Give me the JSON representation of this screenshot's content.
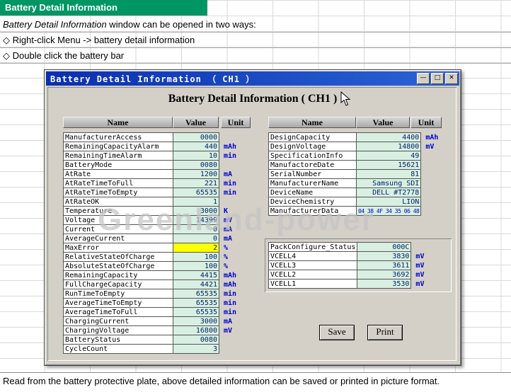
{
  "colors": {
    "header_green": "#009664",
    "titlebar_blue_start": "#0a2fae",
    "titlebar_blue_end": "#2b64d6",
    "value_bg": "#d8efe2",
    "unit_blue": "#0000cc",
    "highlight_yellow": "#ffff00"
  },
  "page": {
    "header": "Battery Detail Information",
    "intro_italic": "Battery Detail Information",
    "intro_rest": " window can be opened in two ways:",
    "bullet1": "◇ Right-click Menu -> battery detail information",
    "bullet2": "◇ Double click the battery bar",
    "footer": "Read from the battery protective plate, above detailed information can be saved or printed in picture format."
  },
  "watermark": "Greenland-power",
  "window": {
    "title": "Battery Detail Information （ CH1 ）",
    "heading": "Battery Detail Information ( CH1 )",
    "controls": {
      "minimize": "—",
      "maximize": "□",
      "close": "✕"
    },
    "save_label": "Save",
    "print_label": "Print"
  },
  "table_headers": {
    "name": "Name",
    "value": "Value",
    "unit": "Unit"
  },
  "left_table": [
    {
      "name": "ManufacturerAccess",
      "value": "0000",
      "unit": ""
    },
    {
      "name": "RemainingCapacityAlarm",
      "value": "440",
      "unit": "mAh"
    },
    {
      "name": "RemainingTimeAlarm",
      "value": "10",
      "unit": "min"
    },
    {
      "name": "BatteryMode",
      "value": "0080",
      "unit": ""
    },
    {
      "name": "AtRate",
      "value": "1200",
      "unit": "mA"
    },
    {
      "name": "AtRateTimeToFull",
      "value": "221",
      "unit": "min"
    },
    {
      "name": "AtRateTimeToEmpty",
      "value": "65535",
      "unit": "min"
    },
    {
      "name": "AtRateOK",
      "value": "1",
      "unit": ""
    },
    {
      "name": "Temperature",
      "value": "3000",
      "unit": "K"
    },
    {
      "name": "Voltage",
      "value": "14399",
      "unit": "mV"
    },
    {
      "name": "Current",
      "value": "0",
      "unit": "mA"
    },
    {
      "name": "AverageCurrent",
      "value": "0",
      "unit": "mA"
    },
    {
      "name": "MaxError",
      "value": "2",
      "unit": "%",
      "highlight": true
    },
    {
      "name": "RelativeStateOfCharge",
      "value": "100",
      "unit": "%"
    },
    {
      "name": "AbsoluteStateOfCharge",
      "value": "100",
      "unit": "%"
    },
    {
      "name": "RemainingCapacity",
      "value": "4415",
      "unit": "mAh"
    },
    {
      "name": "FullChargeCapacity",
      "value": "4421",
      "unit": "mAh"
    },
    {
      "name": "RunTimeToEmpty",
      "value": "65535",
      "unit": "min"
    },
    {
      "name": "AverageTimeToEmpty",
      "value": "65535",
      "unit": "min"
    },
    {
      "name": "AverageTimeToFull",
      "value": "65535",
      "unit": "min"
    },
    {
      "name": "ChargingCurrent",
      "value": "3000",
      "unit": "mA"
    },
    {
      "name": "ChargingVoltage",
      "value": "16800",
      "unit": "mV"
    },
    {
      "name": "BatteryStatus",
      "value": "0080",
      "unit": ""
    },
    {
      "name": "CycleCount",
      "value": "3",
      "unit": ""
    }
  ],
  "right_table": [
    {
      "name": "DesignCapacity",
      "value": "4400",
      "unit": "mAh"
    },
    {
      "name": "DesignVoltage",
      "value": "14800",
      "unit": "mV"
    },
    {
      "name": "SpecificationInfo",
      "value": "49",
      "unit": ""
    },
    {
      "name": "ManufactoreDate",
      "value": "15621",
      "unit": ""
    },
    {
      "name": "SerialNumber",
      "value": "81",
      "unit": ""
    },
    {
      "name": "ManufacturerName",
      "value": "Samsung SDI",
      "unit": ""
    },
    {
      "name": "DeviceName",
      "value": "DELL #T2778",
      "unit": ""
    },
    {
      "name": "DeviceChemistry",
      "value": "LION",
      "unit": ""
    },
    {
      "name": "ManufacturerData",
      "value": "04 38 4F 34 35 06 48",
      "unit": "",
      "small": true
    }
  ],
  "pack_table": [
    {
      "name": "PackConfigure_Status",
      "value": "000C",
      "unit": ""
    },
    {
      "name": "VCELL4",
      "value": "3830",
      "unit": "mV"
    },
    {
      "name": "VCELL3",
      "value": "3611",
      "unit": "mV"
    },
    {
      "name": "VCELL2",
      "value": "3692",
      "unit": "mV"
    },
    {
      "name": "VCELL1",
      "value": "3530",
      "unit": "mV"
    }
  ]
}
